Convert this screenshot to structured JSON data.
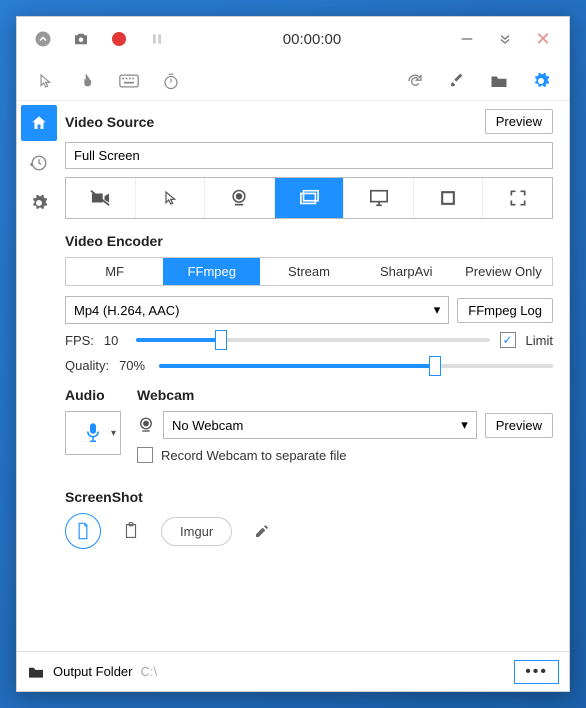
{
  "titlebar": {
    "timer": "00:00:00"
  },
  "sections": {
    "video_source": "Video Source",
    "video_encoder": "Video Encoder",
    "audio": "Audio",
    "webcam": "Webcam",
    "screenshot": "ScreenShot"
  },
  "buttons": {
    "preview": "Preview",
    "ffmpeg_log": "FFmpeg Log",
    "imgur": "Imgur",
    "webcam_preview": "Preview"
  },
  "video_source": {
    "value": "Full Screen",
    "options": [
      "no-video",
      "cursor",
      "webcam-src",
      "screen",
      "monitor",
      "region",
      "fullscreen-brackets"
    ],
    "active_index": 3
  },
  "encoder": {
    "tabs": [
      "MF",
      "FFmpeg",
      "Stream",
      "SharpAvi",
      "Preview Only"
    ],
    "active_index": 1,
    "format": "Mp4 (H.264, AAC)"
  },
  "fps": {
    "label": "FPS:",
    "value": "10",
    "limit_label": "Limit",
    "limit_checked": true,
    "slider_percent": 24
  },
  "quality": {
    "label": "Quality:",
    "value": "70%",
    "slider_percent": 70
  },
  "webcam": {
    "selected": "No Webcam",
    "separate_label": "Record Webcam to separate file",
    "separate_checked": false
  },
  "footer": {
    "label": "Output Folder",
    "path": "C:\\"
  }
}
